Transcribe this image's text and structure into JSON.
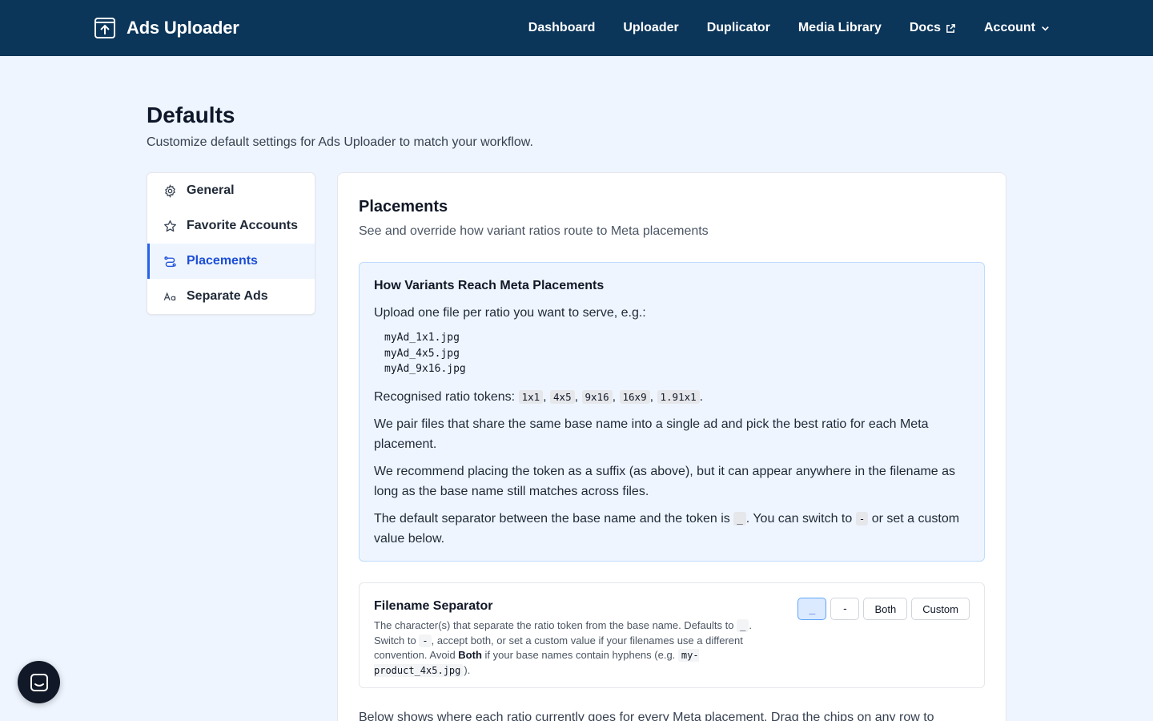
{
  "brand": {
    "name": "Ads Uploader",
    "icon": "upload-box-icon"
  },
  "nav": {
    "items": [
      {
        "label": "Dashboard"
      },
      {
        "label": "Uploader"
      },
      {
        "label": "Duplicator"
      },
      {
        "label": "Media Library"
      },
      {
        "label": "Docs",
        "icon": "external-link-icon"
      },
      {
        "label": "Account",
        "icon": "chevron-down-icon"
      }
    ]
  },
  "page": {
    "title": "Defaults",
    "subtitle": "Customize default settings for Ads Uploader to match your workflow."
  },
  "sidebar": {
    "items": [
      {
        "label": "General",
        "icon": "gear-icon"
      },
      {
        "label": "Favorite Accounts",
        "icon": "star-icon"
      },
      {
        "label": "Placements",
        "icon": "route-icon",
        "active": true
      },
      {
        "label": "Separate Ads",
        "icon": "text-case-icon"
      }
    ]
  },
  "placements": {
    "title": "Placements",
    "subtitle": "See and override how variant ratios route to Meta placements",
    "info": {
      "heading": "How Variants Reach Meta Placements",
      "intro": "Upload one file per ratio you want to serve, e.g.:",
      "examples": [
        "myAd_1x1.jpg",
        "myAd_4x5.jpg",
        "myAd_9x16.jpg"
      ],
      "tokens_label": "Recognised ratio tokens:",
      "tokens": [
        "1x1",
        "4x5",
        "9x16",
        "16x9",
        "1.91x1"
      ],
      "pairing": "We pair files that share the same base name into a single ad and pick the best ratio for each Meta placement.",
      "suffix_note": "We recommend placing the token as a suffix (as above), but it can appear anywhere in the filename as long as the base name still matches across files.",
      "separator_pre": "The default separator between the base name and the token is",
      "separator_default": "_",
      "separator_mid": ". You can switch to",
      "separator_alt": "-",
      "separator_post": "or set a custom value below."
    },
    "separator": {
      "title": "Filename Separator",
      "desc_1": "The character(s) that separate the ratio token from the base name. Defaults to",
      "desc_default": "_",
      "desc_2": ". Switch to",
      "desc_alt": "-",
      "desc_3": ", accept both, or set a custom value if your filenames use a different convention. Avoid",
      "desc_both": "Both",
      "desc_4": "if your base names contain hyphens (e.g.",
      "desc_example": "my-product_4x5.jpg",
      "desc_5": ").",
      "options": [
        "_",
        "-",
        "Both",
        "Custom"
      ],
      "selected": "_"
    },
    "bottom_text": "Below shows where each ratio currently goes for every Meta placement. Drag the chips on any row to"
  },
  "chat": {
    "icon": "chat-icon"
  }
}
